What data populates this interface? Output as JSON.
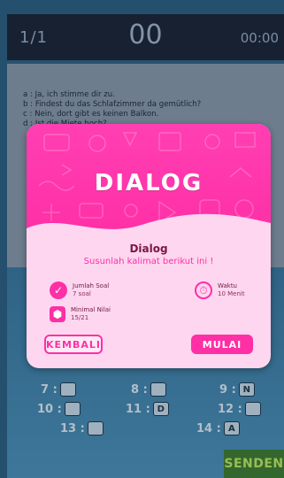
{
  "topbar": {
    "progress": "1/1",
    "score": "00",
    "timer": "00:00"
  },
  "question": {
    "lines": [
      "a : Ja, ich stimme dir zu.",
      "b : Findest du das Schlafzimmer da gemütlich?",
      "c : Nein, dort gibt es keinen Balkon.",
      "d : Ist die Miete hoch?"
    ]
  },
  "answers": [
    {
      "label": "7 :",
      "value": ""
    },
    {
      "label": "8 :",
      "value": ""
    },
    {
      "label": "9 :",
      "value": "N"
    },
    {
      "label": "10 :",
      "value": ""
    },
    {
      "label": "11 :",
      "value": "D"
    },
    {
      "label": "12 :",
      "value": ""
    },
    {
      "label": "13 :",
      "value": ""
    },
    {
      "label": "14 :",
      "value": "A"
    }
  ],
  "send_label": "SENDEN",
  "dialog": {
    "hero_title": "DIALOG",
    "title": "Dialog",
    "subtitle": "Susunlah kalimat berikut ini !",
    "count_label": "Jumlah Soal",
    "count_value": "7 soal",
    "time_label": "Waktu",
    "time_value": "10 Menit",
    "min_label": "Minimal Nilai",
    "min_value": "15/21",
    "back_label": "KEMBALI",
    "start_label": "MULAI",
    "accent": "#ff2fa6"
  }
}
